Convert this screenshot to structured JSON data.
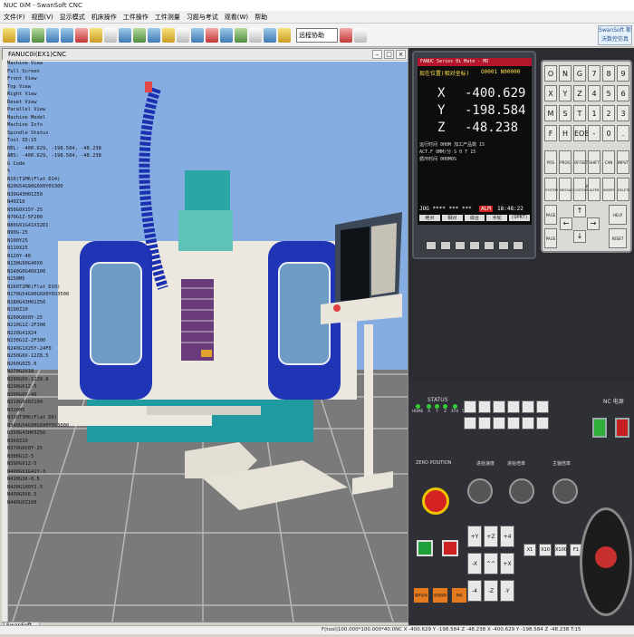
{
  "window": {
    "title": "NUC 0iM - SwanSoft CNC"
  },
  "menu": [
    "文件(F)",
    "视图(V)",
    "显示模式",
    "机床操作",
    "工件操作",
    "工件测量",
    "习题与考试",
    "观看(W)",
    "帮助"
  ],
  "toolbar": {
    "mode_select": "远程协助",
    "logo": "SwanSoft 斯沃数控仿真"
  },
  "sim_window": {
    "title": "FANUC0i(EX1)CNC"
  },
  "tree": [
    "Machine View",
    "  Full Screen",
    "  Front View",
    "  Top View",
    "  Right View",
    "  Reset View",
    "  Parallel View",
    "  Machine Model",
    "Machine Info",
    "  Spindle Status",
    "  Tool ID:15",
    "  REL: -400.629, -198.584, -48.238",
    "  ABS: -400.629, -198.584, -48.238",
    "G Code",
    "  %",
    "  N10(T1M6(Flat D14)",
    "  N20G54G90G0X0Y0S300",
    "  N30G43H01Z50",
    "  N40Z10",
    "  N50G0X15Y-25",
    "  N70G1Z-5F200",
    "  N80G91G41X32D1",
    "  N90G-25",
    "  N100Y25",
    "  N110X25",
    "  N120Y-40",
    "  N130G90G40X0",
    "  N140G0G40X100",
    "  N150M5",
    "  N160T2M6(Flat D10)",
    "  N170G54G90G0X0Y0S3500",
    "  N180G43H02Z50",
    "  N190Z10",
    "  N200G0X0Y-25",
    "  N210G1Z-2F300",
    "  N220G41X24",
    "  N230G1Z-2F300",
    "  N240G1X25Y-24F0",
    "  N250G0X-12Z8.5",
    "  N260G0Z5.0",
    "  N270G2X18",
    "  N280G0X-12Z8.8",
    "  N290G01Z-5",
    "  N300G0X-40",
    "  N310G0X0Z100",
    "  N320M5",
    "  N330T3M6(Flat D6)",
    "  N340G54G90G0X0Y0S3000",
    "  N350G43H03Z50",
    "  N360Z10",
    "  N370G0X0Y-25",
    "  N380G1Z-5",
    "  N390G91Z-5",
    "  N400G91G41Y-3",
    "  N410G3X-8.5",
    "  N420G1X0Y2.5",
    "  N430G9X6.5",
    "  N440G0Z100"
  ],
  "bottom_tab": "SwanSoft CNC",
  "status_text": "F(tool)100.000*100.000*40.0NC   X -400.629  Y -198.584  Z -48.238   X -400.629  Y -198.584  Z -48.238   T:15",
  "lcd": {
    "header": "FANUC Series 0i Mate - MD",
    "title": "现在位置(相对坐标)",
    "prog": "O0001 N00000",
    "axes": [
      {
        "name": "X",
        "value": "-400.629"
      },
      {
        "name": "Y",
        "value": "-198.584"
      },
      {
        "name": "Z",
        "value": "-48.238"
      }
    ],
    "row1_left": "运行时间",
    "row1_mid": "0H0M",
    "row1_right": "加工产品数 15",
    "row2_left": "ACT.F",
    "row2_mid": "0MM/分",
    "row2_right": "循环时间 0H0M0S",
    "row2_s": "S 0",
    "row2_t": "T 15",
    "mode": "JOG **** *** ***",
    "alm": "ALM",
    "time": "18:48:22",
    "softkeys": [
      "绝对",
      "相对",
      "综合",
      "手轮",
      "(OPRT)"
    ]
  },
  "keypad": {
    "rows": [
      [
        "O",
        "N",
        "G",
        "7",
        "8",
        "9"
      ],
      [
        "X",
        "Y",
        "Z",
        "4",
        "5",
        "6"
      ],
      [
        "M",
        "S",
        "T",
        "1",
        "2",
        "3"
      ],
      [
        "F",
        "H",
        "EOB",
        "-",
        "0",
        "."
      ]
    ],
    "func": [
      "POS",
      "PROG",
      "OFFSET SETTING",
      "SHIFT",
      "CAN",
      "INPUT"
    ],
    "func2": [
      "SYSTEM",
      "MESSAGE",
      "CUSTOM GRAPH",
      "ALTER",
      "INSERT",
      "DELETE"
    ],
    "page_up": "PAGE",
    "page_down": "PAGE",
    "help": "HELP",
    "reset": "RESET"
  },
  "panel": {
    "status": "STATUS",
    "status_lamps": [
      "HOME",
      "X",
      "Y",
      "Z",
      "4TH",
      "5TH"
    ],
    "nc_power": "NC 电源",
    "estop": "急停",
    "zero_position": "ZERO POSITION",
    "feed_rate": "进给倍率",
    "spindle_rate": "主轴倍率",
    "feed_label": "进给速度",
    "jog_labels": [
      "+Y",
      "+Z",
      "+4",
      "-X",
      "^^",
      "+X",
      "-4",
      "-Z",
      "-Y"
    ],
    "mode_keys": [
      "X1",
      "X10",
      "X100",
      "F1"
    ],
    "cycle_keys": [
      "循环启动",
      "进给保持",
      "单段"
    ]
  }
}
